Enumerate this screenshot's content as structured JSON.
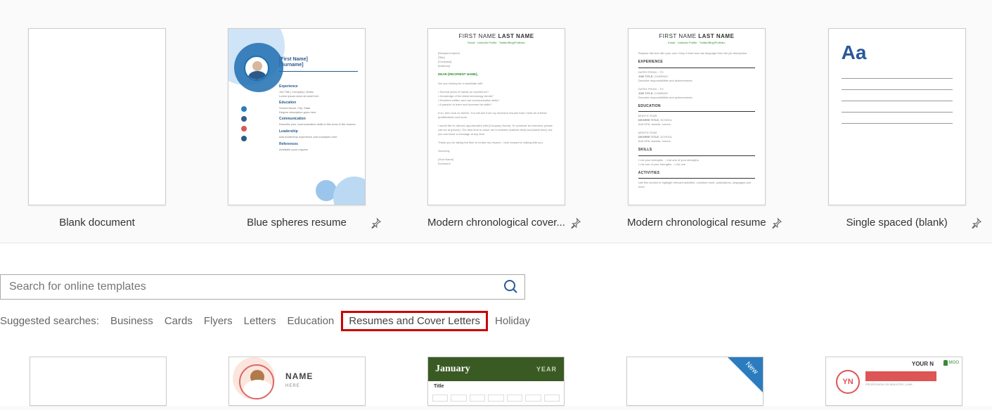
{
  "templates_top": [
    {
      "label": "Blank document",
      "pinnable": false
    },
    {
      "label": "Blue spheres resume",
      "pinnable": true,
      "name1": "[First Name]",
      "name2": "[Surname]",
      "sections": [
        "Experience",
        "Education",
        "Communication",
        "Leadership",
        "References"
      ]
    },
    {
      "label": "Modern chronological cover...",
      "pinnable": true,
      "heading_first": "FIRST NAME",
      "heading_last": "LAST NAME",
      "sub": "Email · LinkedIn Profile · Twitter/Blog/Portfolio",
      "recipient": "DEAR [RECIPIENT NAME],"
    },
    {
      "label": "Modern chronological resume",
      "pinnable": true,
      "heading_first": "FIRST NAME",
      "heading_last": "LAST NAME",
      "sub": "Email · LinkedIn Profile · Twitter/Blog/Portfolio",
      "sections": [
        "EXPERIENCE",
        "EDUCATION",
        "SKILLS",
        "ACTIVITIES"
      ]
    },
    {
      "label": "Single spaced (blank)",
      "pinnable": true,
      "glyph": "Aa"
    }
  ],
  "search": {
    "placeholder": "Search for online templates"
  },
  "suggested": {
    "label": "Suggested searches:",
    "items": [
      "Business",
      "Cards",
      "Flyers",
      "Letters",
      "Education",
      "Resumes and Cover Letters",
      "Holiday"
    ],
    "highlighted": "Resumes and Cover Letters"
  },
  "templates_bottom": [
    {
      "kind": "blank"
    },
    {
      "kind": "photo_resume",
      "name": "NAME",
      "sub": "HERE"
    },
    {
      "kind": "calendar",
      "month": "January",
      "year": "YEAR",
      "title": "Title"
    },
    {
      "kind": "new_doc",
      "badge": "New"
    },
    {
      "kind": "moo",
      "initials": "YN",
      "name": "YOUR N",
      "moo": "MOO"
    }
  ]
}
